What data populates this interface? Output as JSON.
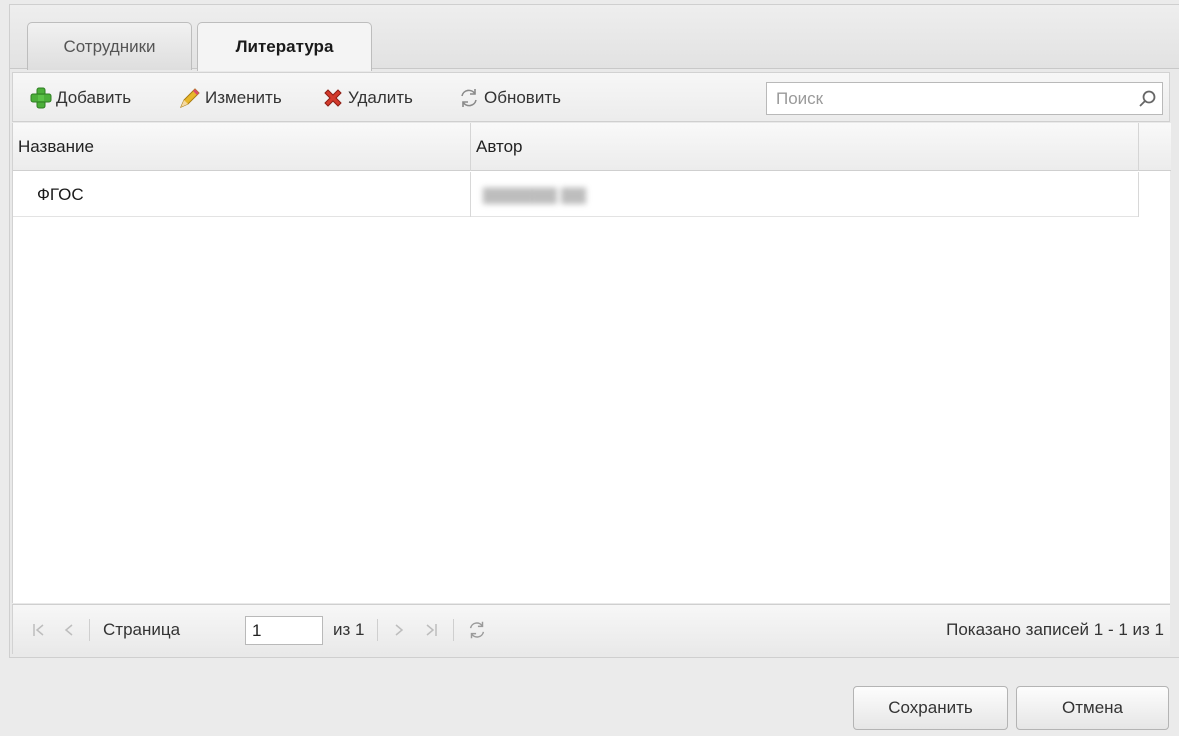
{
  "tabs": [
    {
      "label": "Сотрудники",
      "active": false
    },
    {
      "label": "Литература",
      "active": true
    }
  ],
  "toolbar": {
    "add_label": "Добавить",
    "edit_label": "Изменить",
    "delete_label": "Удалить",
    "refresh_label": "Обновить",
    "search_placeholder": "Поиск"
  },
  "grid": {
    "columns": [
      "Название",
      "Автор"
    ],
    "rows": [
      {
        "name": "ФГОС",
        "author": "(blurred)"
      }
    ]
  },
  "paging": {
    "page_label": "Страница",
    "page_value": "1",
    "of_label": "из 1",
    "display_info": "Показано записей 1 - 1 из 1"
  },
  "buttons": {
    "save_label": "Сохранить",
    "cancel_label": "Отмена"
  },
  "colors": {
    "add_icon": "#4caf3a",
    "delete_icon": "#d33a2c",
    "edit_icon": "#e3b020"
  },
  "icons": [
    "add-icon",
    "edit-icon",
    "delete-icon",
    "refresh-icon",
    "search-icon",
    "first-page-icon",
    "prev-page-icon",
    "next-page-icon",
    "last-page-icon"
  ]
}
